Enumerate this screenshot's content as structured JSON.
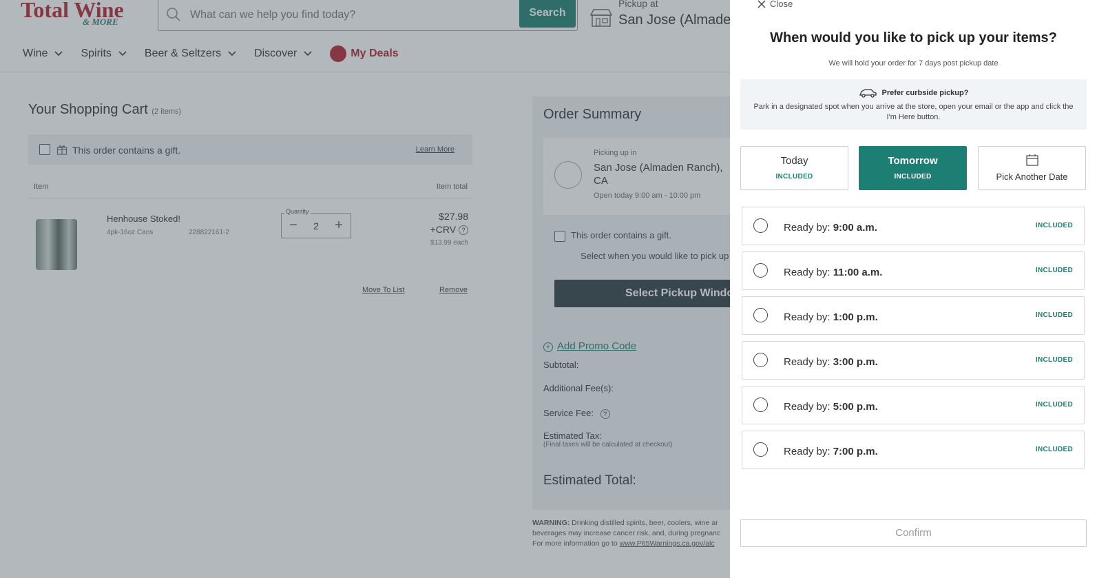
{
  "header": {
    "logo_main": "Total Wine",
    "logo_sub": "& MORE",
    "search_placeholder": "What can we help you find today?",
    "search_button": "Search",
    "pickup_label": "Pickup at",
    "pickup_store": "San Jose (Almaden"
  },
  "nav": {
    "items": [
      "Wine",
      "Spirits",
      "Beer & Seltzers",
      "Discover"
    ],
    "deals": "My Deals"
  },
  "cart": {
    "title": "Your Shopping Cart",
    "count": "(2 items)",
    "gift_text": "This order contains a gift.",
    "learn_more": "Learn More",
    "col_item": "Item",
    "col_total": "Item total",
    "product": {
      "name": "Henhouse Stoked!",
      "volume": "4pk-16oz Cans",
      "sku": "228822161-2",
      "quantity_label": "Quantity",
      "quantity": "2",
      "price": "$27.98",
      "crv": "+CRV",
      "each": "$13.99 each"
    },
    "move_to_list": "Move To List",
    "remove": "Remove"
  },
  "summary": {
    "title": "Order Summary",
    "picking_up_in": "Picking up in",
    "store": "San Jose (Almaden Ranch), CA",
    "hours": "Open today 9:00 am - 10:00 pm",
    "gift_text": "This order contains a gift.",
    "select_text": "Select when you would like to pick up",
    "select_button": "Select Pickup Window",
    "promo": "Add Promo Code",
    "subtotal": "Subtotal:",
    "additional_fees": "Additional Fee(s):",
    "service_fee": "Service Fee:",
    "estimated_tax": "Estimated Tax:",
    "tax_note": "(Final taxes will be calculated at checkout)",
    "estimated_total": "Estimated Total:",
    "warning_label": "WARNING:",
    "warning_line1": "Drinking distilled spirits, beer, coolers, wine ar",
    "warning_line2": "beverages may increase cancer risk, and, during pregnanc",
    "warning_line3_prefix": "For more information go to ",
    "warning_link": "www.P65Warnings.ca.gov/alc"
  },
  "drawer": {
    "close": "Close",
    "title": "When would you like to pick up your items?",
    "subtitle": "We will hold your order for 7 days post pickup date",
    "curbside_title": "Prefer curbside pickup?",
    "curbside_desc": "Park in a designated spot when you arrive at the store, open your email or the app and click the I'm Here button.",
    "tabs": [
      {
        "label": "Today",
        "sub": "INCLUDED"
      },
      {
        "label": "Tomorrow",
        "sub": "INCLUDED"
      },
      {
        "label": "Pick Another Date"
      }
    ],
    "selected_tab": "Tomorrow",
    "ready_prefix": "Ready by:",
    "slots": [
      {
        "time": "9:00 a.m.",
        "fee": "INCLUDED"
      },
      {
        "time": "11:00 a.m.",
        "fee": "INCLUDED"
      },
      {
        "time": "1:00 p.m.",
        "fee": "INCLUDED"
      },
      {
        "time": "3:00 p.m.",
        "fee": "INCLUDED"
      },
      {
        "time": "5:00 p.m.",
        "fee": "INCLUDED"
      },
      {
        "time": "7:00 p.m.",
        "fee": "INCLUDED"
      }
    ],
    "confirm": "Confirm"
  },
  "colors": {
    "brand_red": "#b0212f",
    "accent_teal": "#1d7f74",
    "dark_button": "#2c3c42"
  }
}
